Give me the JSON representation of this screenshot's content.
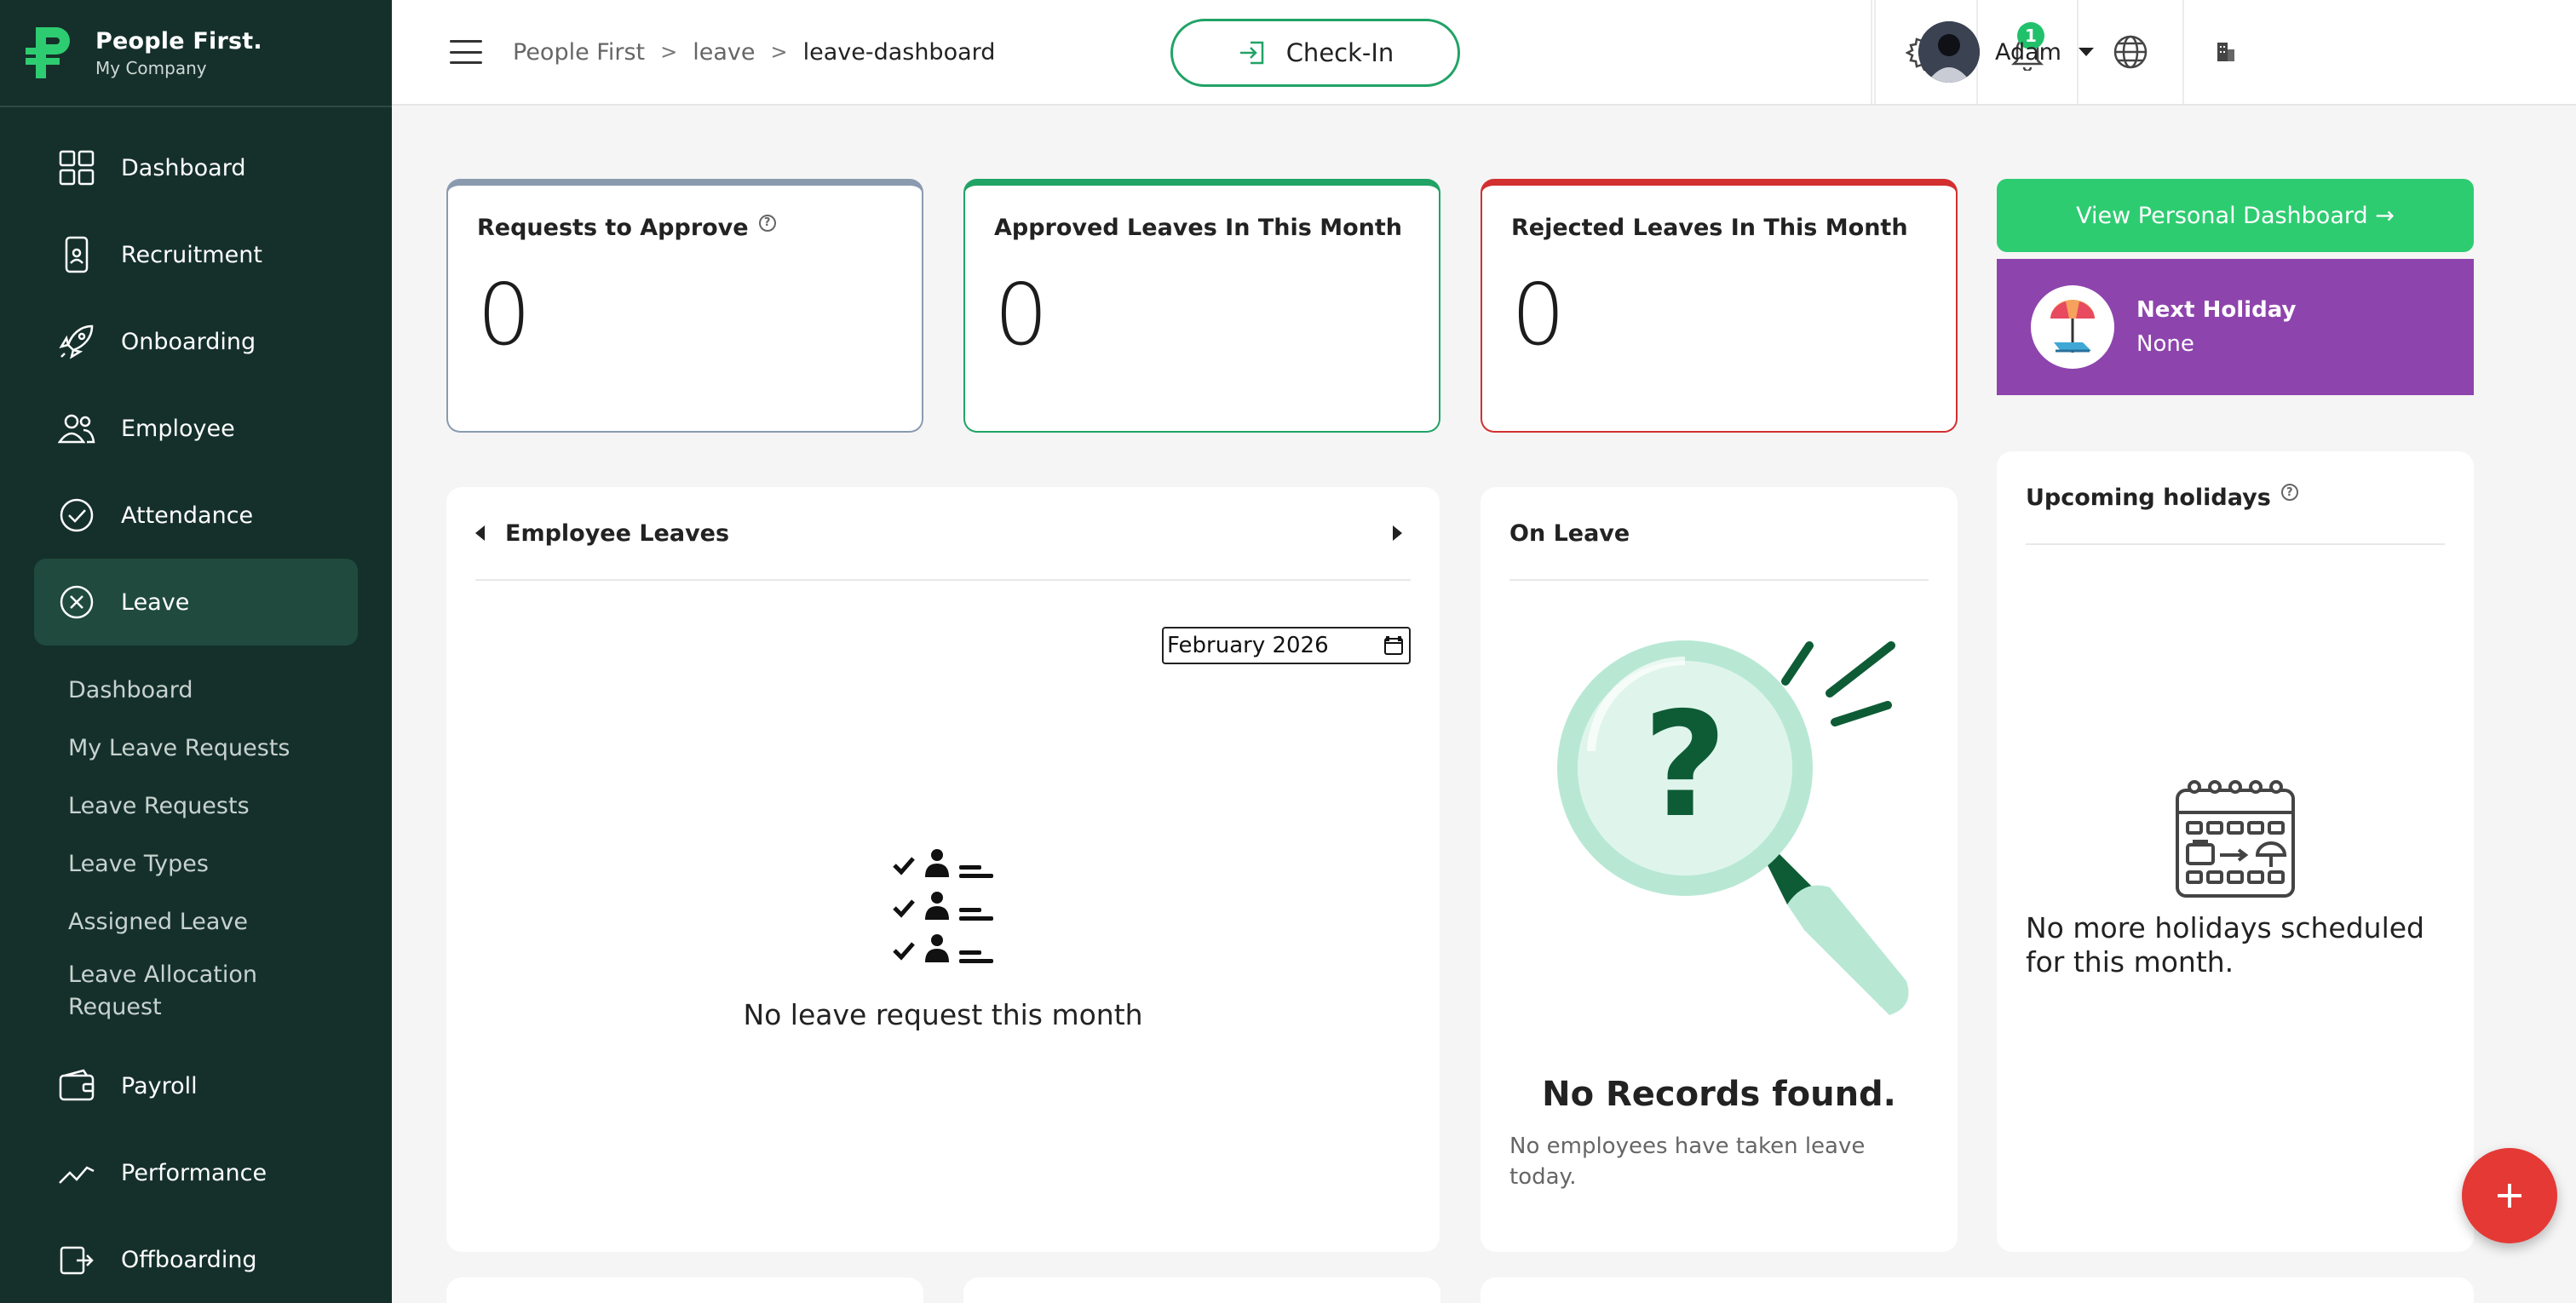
{
  "brand": {
    "name": "People First.",
    "company": "My Company",
    "color": "#2ecc71"
  },
  "sidebar": {
    "items": [
      {
        "label": "Dashboard",
        "icon": "grid-icon"
      },
      {
        "label": "Recruitment",
        "icon": "phone-badge-icon"
      },
      {
        "label": "Onboarding",
        "icon": "rocket-icon"
      },
      {
        "label": "Employee",
        "icon": "people-icon"
      },
      {
        "label": "Attendance",
        "icon": "check-circle-icon"
      },
      {
        "label": "Leave",
        "icon": "x-circle-icon",
        "active": true
      },
      {
        "label": "Payroll",
        "icon": "wallet-icon"
      },
      {
        "label": "Performance",
        "icon": "trend-icon"
      },
      {
        "label": "Offboarding",
        "icon": "exit-icon"
      }
    ],
    "leave_sub": [
      "Dashboard",
      "My Leave Requests",
      "Leave Requests",
      "Leave Types",
      "Assigned Leave",
      "Leave Allocation Request"
    ]
  },
  "header": {
    "breadcrumb": [
      "People First",
      "leave",
      "leave-dashboard"
    ],
    "checkin_label": "Check-In",
    "notification_count": "1",
    "user_name": "Adam"
  },
  "stats": [
    {
      "title": "Requests to Approve",
      "value": "0",
      "color": "#8a9bb0",
      "help": "?"
    },
    {
      "title": "Approved Leaves In This Month",
      "value": "0",
      "color": "#21a366"
    },
    {
      "title": "Rejected Leaves In This Month",
      "value": "0",
      "color": "#d32f2f"
    }
  ],
  "personal_dashboard": {
    "label": "View Personal Dashboard →"
  },
  "next_holiday": {
    "title": "Next Holiday",
    "value": "None"
  },
  "employee_leaves": {
    "title": "Employee Leaves",
    "month_value": "February 2026",
    "empty_text": "No leave request this month"
  },
  "on_leave": {
    "title": "On Leave",
    "empty_title": "No Records found.",
    "empty_sub": "No employees have taken leave today."
  },
  "upcoming_holidays": {
    "title": "Upcoming holidays",
    "help": "?",
    "empty_text": "No more holidays scheduled for this month."
  },
  "fab": {
    "label": "+"
  }
}
